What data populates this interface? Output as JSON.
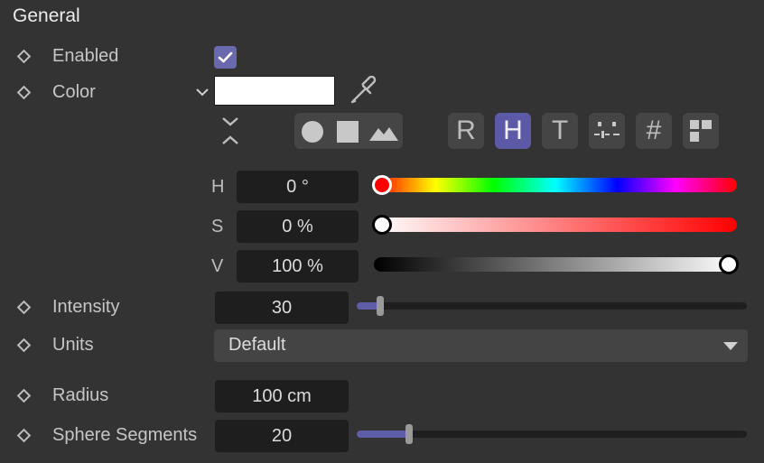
{
  "section": {
    "title": "General"
  },
  "rows": {
    "enabled": {
      "label": "Enabled",
      "checked": true
    },
    "color": {
      "label": "Color",
      "swatch_color": "#ffffff"
    },
    "intensity": {
      "label": "Intensity",
      "value": "30",
      "slider_fraction": 0.06
    },
    "units": {
      "label": "Units",
      "value": "Default"
    },
    "radius": {
      "label": "Radius",
      "value": "100 cm"
    },
    "sphere_segments": {
      "label": "Sphere Segments",
      "value": "20",
      "slider_fraction": 0.135
    }
  },
  "color_picker": {
    "mode_icons": [
      "circle-icon",
      "square-icon",
      "mountain-icon"
    ],
    "tool_buttons": [
      {
        "label": "R",
        "active": false
      },
      {
        "label": "H",
        "active": true
      },
      {
        "label": "T",
        "active": false
      },
      {
        "label": "",
        "icon": "mixer-icon",
        "active": false
      },
      {
        "label": "#",
        "active": false
      },
      {
        "label": "",
        "icon": "swatches-grid-icon",
        "active": false
      }
    ],
    "hsv": {
      "h": {
        "label": "H",
        "value": "0 °",
        "fraction": 0.0
      },
      "s": {
        "label": "S",
        "value": "0 %",
        "fraction": 0.0
      },
      "v": {
        "label": "V",
        "value": "100 %",
        "fraction": 1.0
      }
    }
  },
  "colors": {
    "accent": "#5c5aa6",
    "background": "#333333",
    "field": "#1e1e1e"
  }
}
